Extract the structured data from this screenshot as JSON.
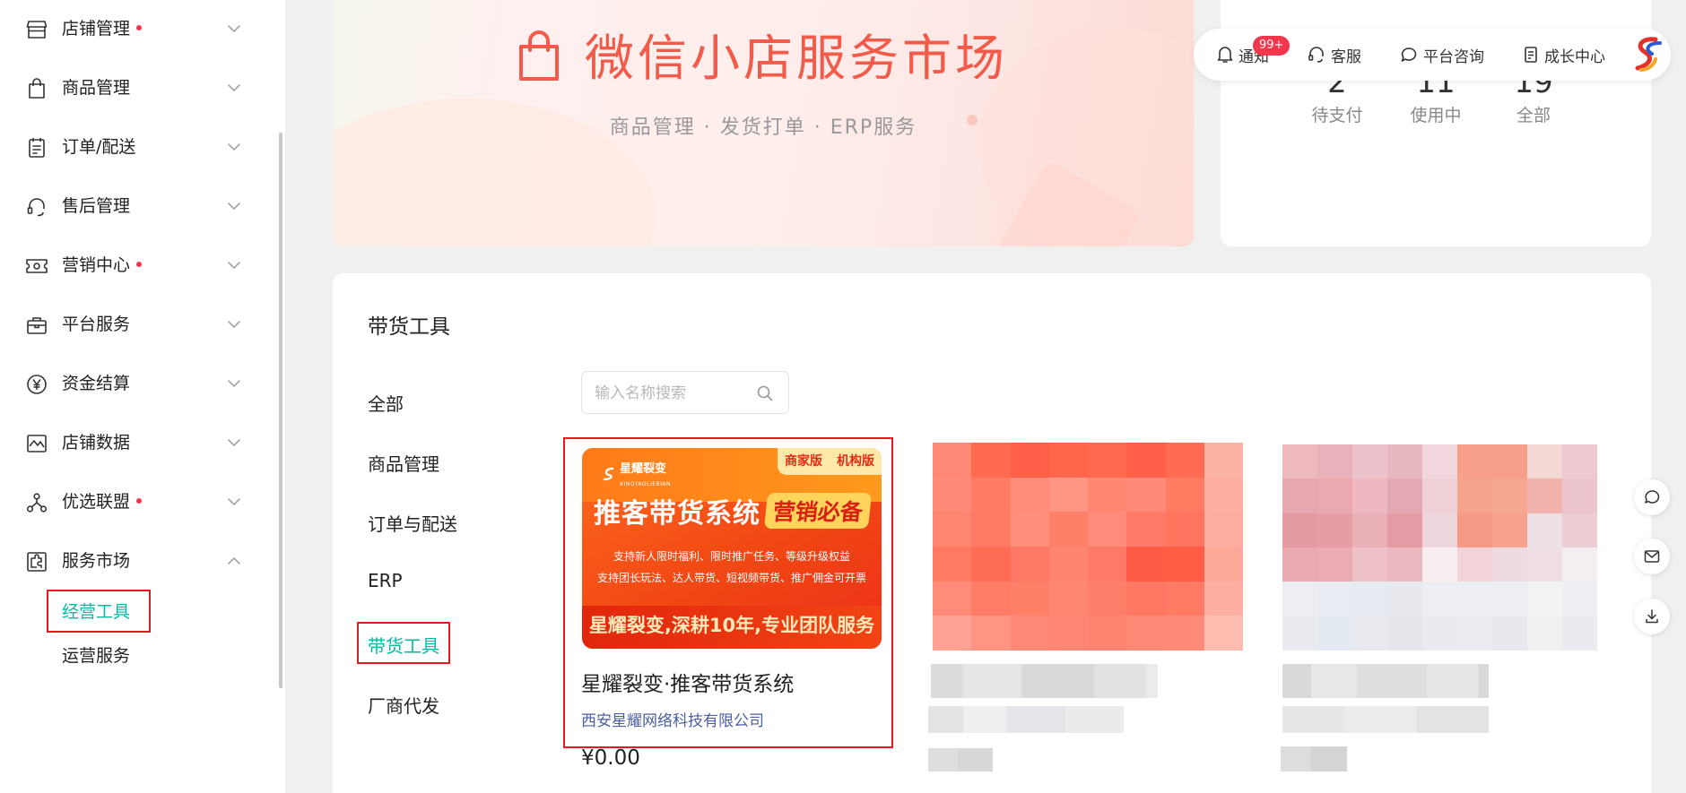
{
  "sidebar": {
    "items": [
      {
        "label": "店铺管理",
        "icon": "store-icon",
        "dot": true
      },
      {
        "label": "商品管理",
        "icon": "shopping-bag-icon",
        "dot": false
      },
      {
        "label": "订单/配送",
        "icon": "order-list-icon",
        "dot": false
      },
      {
        "label": "售后管理",
        "icon": "headset-icon",
        "dot": false
      },
      {
        "label": "营销中心",
        "icon": "ticket-icon",
        "dot": true
      },
      {
        "label": "平台服务",
        "icon": "briefcase-icon",
        "dot": false
      },
      {
        "label": "资金结算",
        "icon": "yen-icon",
        "dot": false
      },
      {
        "label": "店铺数据",
        "icon": "chart-line-icon",
        "dot": false
      },
      {
        "label": "优选联盟",
        "icon": "network-icon",
        "dot": true
      },
      {
        "label": "服务市场",
        "icon": "puzzle-icon",
        "dot": false
      }
    ],
    "subitems": [
      {
        "label": "经营工具",
        "active": true
      },
      {
        "label": "运营服务",
        "active": false
      }
    ]
  },
  "banner": {
    "title": "微信小店服务市场",
    "subtitle": "商品管理 · 发货打单 · ERP服务"
  },
  "orders": {
    "stats": [
      {
        "num": "2",
        "label": "待支付"
      },
      {
        "num": "11",
        "label": "使用中"
      },
      {
        "num": "19",
        "label": "全部"
      }
    ]
  },
  "topnav": {
    "notify": "通知",
    "badge": "99+",
    "service": "客服",
    "consult": "平台咨询",
    "growth": "成长中心"
  },
  "main": {
    "section_title": "带货工具",
    "categories": [
      {
        "label": "全部",
        "active": false
      },
      {
        "label": "商品管理",
        "active": false
      },
      {
        "label": "订单与配送",
        "active": false
      },
      {
        "label": "ERP",
        "active": false
      },
      {
        "label": "带货工具",
        "active": true
      },
      {
        "label": "厂商代发",
        "active": false
      }
    ],
    "search_placeholder": "输入名称搜索",
    "product": {
      "image": {
        "brand": "星耀裂变",
        "brand_sub": "XINGYAOLIEBIAN",
        "tag1": "商家版",
        "tag2": "机构版",
        "headline": "推客带货系统",
        "headline_badge": "营销必备",
        "line1": "支持新人限时福利、限时推广任务、等级升级权益",
        "line2": "支持团长玩法、达人带货、短视频带货、推广佣金可开票",
        "footer": "星耀裂变,深耕10年,专业团队服务"
      },
      "title": "星耀裂变·推客带货系统",
      "vendor": "西安星耀网络科技有限公司",
      "price": "¥0.00"
    }
  },
  "colors": {
    "accent": "#07b9a4",
    "alert": "#f2364b",
    "banner_title": "#f25b4a",
    "highlight_box": "#e8171d"
  }
}
